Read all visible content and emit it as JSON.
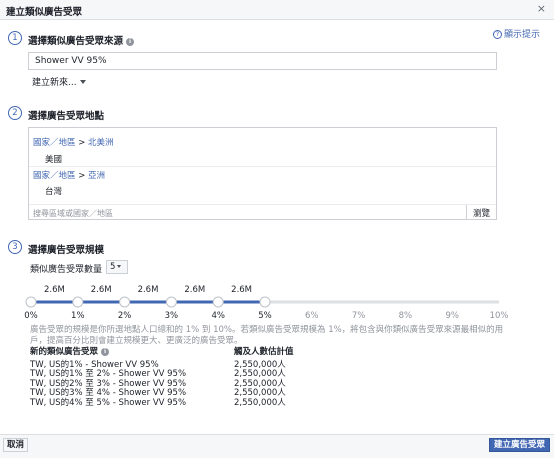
{
  "dialog": {
    "title": "建立類似廣告受眾",
    "close_glyph": "×"
  },
  "tips": {
    "label": "顯示提示",
    "icon": "question-icon"
  },
  "step1": {
    "number": "1",
    "title": "選擇類似廣告受眾來源",
    "source_value": "Shower VV 95%",
    "create_new_label": "建立新來..."
  },
  "step2": {
    "number": "2",
    "title": "選擇廣告受眾地點",
    "locations": [
      {
        "path_prefix": "國家／地區",
        "arrow": ">",
        "region": "北美洲",
        "country": "美國"
      },
      {
        "path_prefix": "國家／地區",
        "arrow": ">",
        "region": "亞洲",
        "country": "台灣"
      }
    ],
    "search_placeholder": "搜尋區域或國家／地區",
    "browse_label": "瀏覽"
  },
  "step3": {
    "number": "3",
    "title": "選擇廣告受眾規模",
    "count_label": "類似廣告受眾數量",
    "count_value": "5",
    "description": "廣告受眾的規模是你所選地點人口總和的 1% 到 10%。若類似廣告受眾規模為 1%，將包含與你類似廣告受眾來源最相似的用戶，提高百分比則會建立規模更大、更廣泛的廣告受眾。"
  },
  "slider": {
    "max_percent": 10,
    "selected_points": [
      0,
      1,
      2,
      3,
      4,
      5
    ],
    "ticks": [
      "0%",
      "1%",
      "2%",
      "3%",
      "4%",
      "5%",
      "6%",
      "7%",
      "8%",
      "9%",
      "10%"
    ],
    "segment_labels": [
      "2.6M",
      "2.6M",
      "2.6M",
      "2.6M",
      "2.6M"
    ],
    "active_color": "#4267b2",
    "inactive_color": "#dddfe2"
  },
  "table": {
    "col1_header": "新的類似廣告受眾",
    "col2_header": "觸及人數估計值",
    "rows": [
      {
        "name": "TW, US的1% - Shower VV 95%",
        "reach": "2,550,000人"
      },
      {
        "name": "TW, US的1% 至 2% - Shower VV 95%",
        "reach": "2,550,000人"
      },
      {
        "name": "TW, US的2% 至 3% - Shower VV 95%",
        "reach": "2,550,000人"
      },
      {
        "name": "TW, US的3% 至 4% - Shower VV 95%",
        "reach": "2,550,000人"
      },
      {
        "name": "TW, US的4% 至 5% - Shower VV 95%",
        "reach": "2,550,000人"
      }
    ]
  },
  "footer": {
    "cancel_label": "取消",
    "create_label": "建立廣告受眾"
  }
}
